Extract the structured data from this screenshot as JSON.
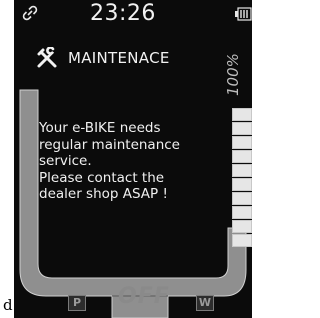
{
  "status": {
    "time": "23:26",
    "link_icon": "link-icon",
    "battery_icon": "battery-icon"
  },
  "battery": {
    "percent_label": "100%",
    "level_fraction": 1.0
  },
  "popup": {
    "icon": "wrench-icon",
    "title": "MAINTENACE",
    "message": "Your e-BIKE needs\nregular maintenance\nservice.\nPlease contact the\ndealer shop ASAP !"
  },
  "mode": {
    "left_label": "P",
    "right_label": "W",
    "assist_label": "OFF"
  },
  "page_caption": "d",
  "colors": {
    "screen_bg": "#0b0b0b",
    "track": "#9a9a9a",
    "text": "#f2f2f2"
  }
}
